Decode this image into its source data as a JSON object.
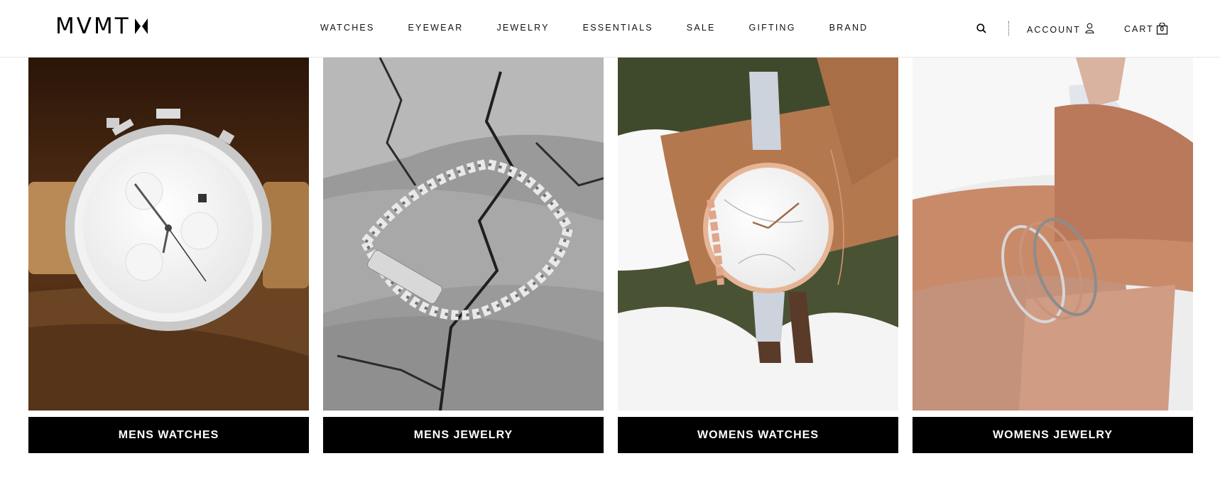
{
  "brand": {
    "logo_text": "MVMT"
  },
  "nav": {
    "items": [
      "Watches",
      "Eyewear",
      "Jewelry",
      "Essentials",
      "Sale",
      "Gifting",
      "Brand"
    ]
  },
  "utility": {
    "account_label": "ACCOUNT",
    "cart_label": "CART",
    "cart_count": "0"
  },
  "categories": [
    {
      "label": "MENS WATCHES"
    },
    {
      "label": "MENS JEWELRY"
    },
    {
      "label": "WOMENS WATCHES"
    },
    {
      "label": "WOMENS JEWELRY"
    }
  ]
}
